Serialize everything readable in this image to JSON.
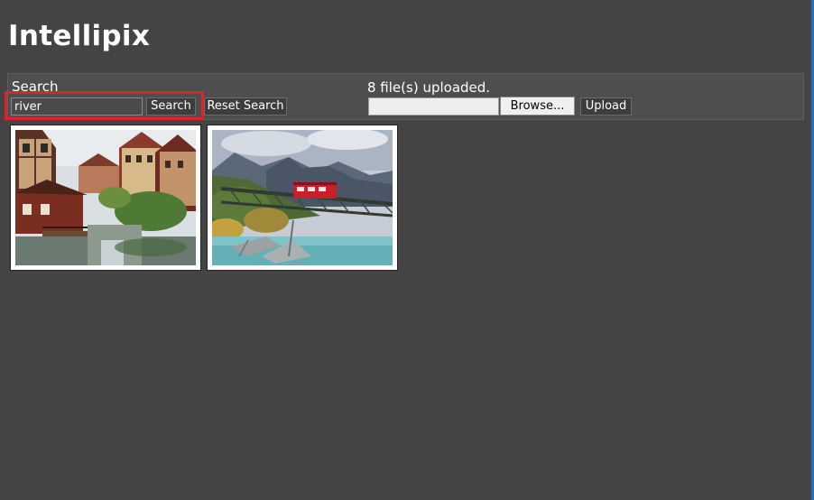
{
  "app": {
    "title": "Intellipix"
  },
  "search": {
    "heading": "Search",
    "query": "river",
    "search_label": "Search",
    "reset_label": "Reset Search"
  },
  "upload": {
    "status": "8 file(s) uploaded.",
    "browse_label": "Browse...",
    "upload_label": "Upload"
  },
  "colors": {
    "background": "#444444",
    "toolbar": "#4e4e4e",
    "highlight": "#e0202a",
    "window_edge": "#1a6fc2"
  },
  "results": [
    {
      "subject": "canal-village-photo"
    },
    {
      "subject": "mountain-train-bridge-photo"
    }
  ]
}
